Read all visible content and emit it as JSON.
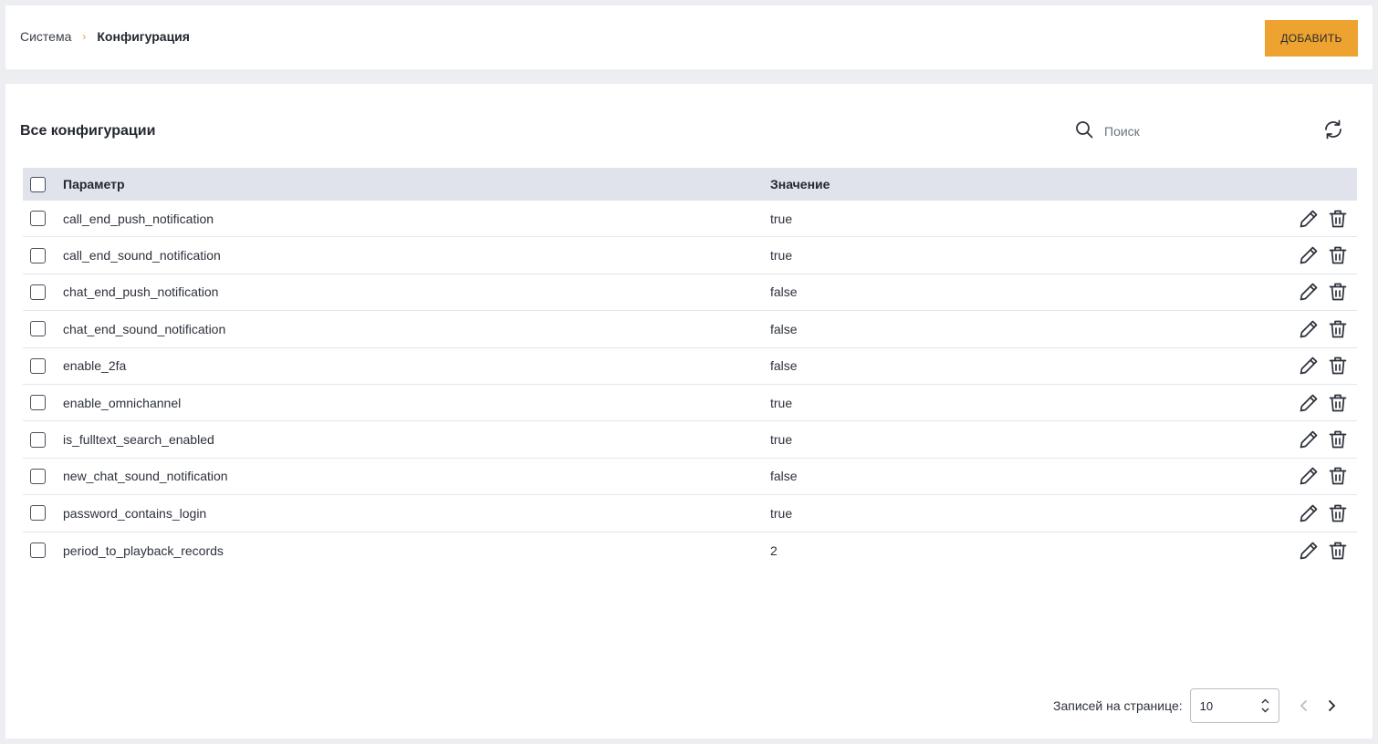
{
  "breadcrumb": {
    "parent": "Система",
    "separator": "›",
    "current": "Конфигурация"
  },
  "header": {
    "add_label": "ДОБАВИТЬ"
  },
  "main": {
    "title": "Все конфигурации",
    "search": {
      "placeholder": "Поиск",
      "value": ""
    }
  },
  "table": {
    "columns": {
      "param": "Параметр",
      "value": "Значение"
    },
    "rows": [
      {
        "param": "call_end_push_notification",
        "value": "true"
      },
      {
        "param": "call_end_sound_notification",
        "value": "true"
      },
      {
        "param": "chat_end_push_notification",
        "value": "false"
      },
      {
        "param": "chat_end_sound_notification",
        "value": "false"
      },
      {
        "param": "enable_2fa",
        "value": "false"
      },
      {
        "param": "enable_omnichannel",
        "value": "true"
      },
      {
        "param": "is_fulltext_search_enabled",
        "value": "true"
      },
      {
        "param": "new_chat_sound_notification",
        "value": "false"
      },
      {
        "param": "password_contains_login",
        "value": "true"
      },
      {
        "param": "period_to_playback_records",
        "value": "2"
      }
    ]
  },
  "pagination": {
    "label": "Записей на странице:",
    "page_size": "10"
  },
  "icons": {
    "search": "search-icon",
    "refresh": "refresh-icon",
    "edit": "pencil-icon",
    "delete": "trash-icon",
    "prev": "chevron-left-icon",
    "next": "chevron-right-icon"
  },
  "colors": {
    "accent": "#eea330",
    "table_header_bg": "#e0e3ec"
  }
}
